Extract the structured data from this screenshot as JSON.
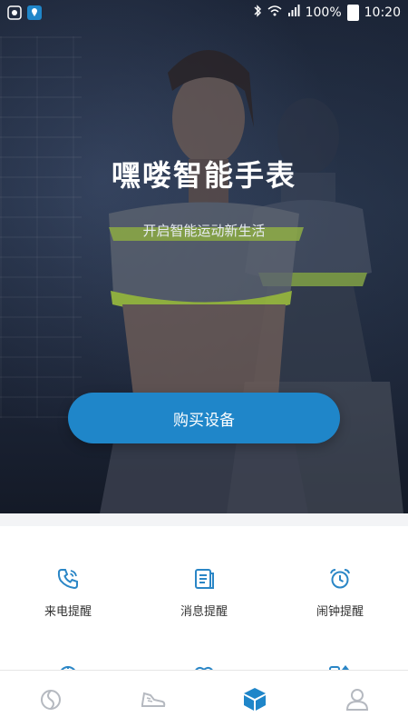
{
  "status_bar": {
    "battery": "100%",
    "time": "10:20",
    "left_icons": [
      "app-icon",
      "location-icon"
    ],
    "right_icons": [
      "bluetooth-icon",
      "wifi-icon",
      "signal-icon",
      "battery-icon"
    ]
  },
  "hero": {
    "title": "嘿喽智能手表",
    "subtitle": "开启智能运动新生活",
    "buy_button": "购买设备"
  },
  "features": [
    {
      "label": "来电提醒",
      "icon": "phone-call-icon"
    },
    {
      "label": "消息提醒",
      "icon": "message-icon"
    },
    {
      "label": "闹钟提醒",
      "icon": "alarm-clock-icon"
    }
  ],
  "nav": {
    "items": [
      "activity-icon",
      "sneaker-icon",
      "device-box-icon",
      "profile-icon"
    ],
    "active": "device-box-icon"
  },
  "colors": {
    "accent": "#1f86c9",
    "icon_blue": "#2a86c6",
    "nav_grey": "#b5b9c0"
  }
}
